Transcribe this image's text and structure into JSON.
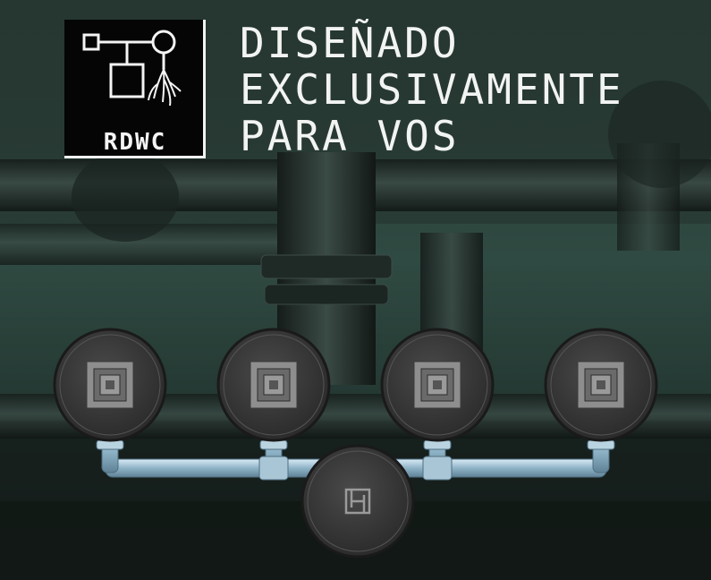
{
  "brand": {
    "logo_text": "RDWC"
  },
  "headline": {
    "line1": "DISEÑADO",
    "line2": "EXCLUSIVAMENTE",
    "line3": "PARA VOS"
  },
  "colors": {
    "background": "#1c2a26",
    "pipe": "#a9c6d6",
    "bucket": "#3c3c3c",
    "text": "#f2f4f2"
  },
  "diagram": {
    "bucket_count": 4,
    "reservoir_icon": "rdwc-reservoir-icon",
    "bucket_icon": "net-pot-icon"
  }
}
